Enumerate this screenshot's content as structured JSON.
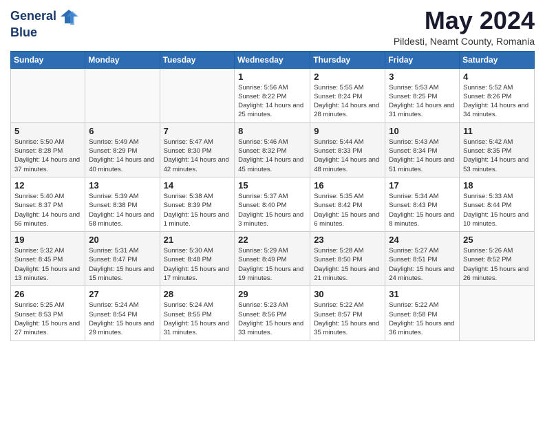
{
  "header": {
    "logo_line1": "General",
    "logo_line2": "Blue",
    "month": "May 2024",
    "location": "Pildesti, Neamt County, Romania"
  },
  "weekdays": [
    "Sunday",
    "Monday",
    "Tuesday",
    "Wednesday",
    "Thursday",
    "Friday",
    "Saturday"
  ],
  "weeks": [
    [
      {
        "day": "",
        "info": ""
      },
      {
        "day": "",
        "info": ""
      },
      {
        "day": "",
        "info": ""
      },
      {
        "day": "1",
        "info": "Sunrise: 5:56 AM\nSunset: 8:22 PM\nDaylight: 14 hours and 25 minutes."
      },
      {
        "day": "2",
        "info": "Sunrise: 5:55 AM\nSunset: 8:24 PM\nDaylight: 14 hours and 28 minutes."
      },
      {
        "day": "3",
        "info": "Sunrise: 5:53 AM\nSunset: 8:25 PM\nDaylight: 14 hours and 31 minutes."
      },
      {
        "day": "4",
        "info": "Sunrise: 5:52 AM\nSunset: 8:26 PM\nDaylight: 14 hours and 34 minutes."
      }
    ],
    [
      {
        "day": "5",
        "info": "Sunrise: 5:50 AM\nSunset: 8:28 PM\nDaylight: 14 hours and 37 minutes."
      },
      {
        "day": "6",
        "info": "Sunrise: 5:49 AM\nSunset: 8:29 PM\nDaylight: 14 hours and 40 minutes."
      },
      {
        "day": "7",
        "info": "Sunrise: 5:47 AM\nSunset: 8:30 PM\nDaylight: 14 hours and 42 minutes."
      },
      {
        "day": "8",
        "info": "Sunrise: 5:46 AM\nSunset: 8:32 PM\nDaylight: 14 hours and 45 minutes."
      },
      {
        "day": "9",
        "info": "Sunrise: 5:44 AM\nSunset: 8:33 PM\nDaylight: 14 hours and 48 minutes."
      },
      {
        "day": "10",
        "info": "Sunrise: 5:43 AM\nSunset: 8:34 PM\nDaylight: 14 hours and 51 minutes."
      },
      {
        "day": "11",
        "info": "Sunrise: 5:42 AM\nSunset: 8:35 PM\nDaylight: 14 hours and 53 minutes."
      }
    ],
    [
      {
        "day": "12",
        "info": "Sunrise: 5:40 AM\nSunset: 8:37 PM\nDaylight: 14 hours and 56 minutes."
      },
      {
        "day": "13",
        "info": "Sunrise: 5:39 AM\nSunset: 8:38 PM\nDaylight: 14 hours and 58 minutes."
      },
      {
        "day": "14",
        "info": "Sunrise: 5:38 AM\nSunset: 8:39 PM\nDaylight: 15 hours and 1 minute."
      },
      {
        "day": "15",
        "info": "Sunrise: 5:37 AM\nSunset: 8:40 PM\nDaylight: 15 hours and 3 minutes."
      },
      {
        "day": "16",
        "info": "Sunrise: 5:35 AM\nSunset: 8:42 PM\nDaylight: 15 hours and 6 minutes."
      },
      {
        "day": "17",
        "info": "Sunrise: 5:34 AM\nSunset: 8:43 PM\nDaylight: 15 hours and 8 minutes."
      },
      {
        "day": "18",
        "info": "Sunrise: 5:33 AM\nSunset: 8:44 PM\nDaylight: 15 hours and 10 minutes."
      }
    ],
    [
      {
        "day": "19",
        "info": "Sunrise: 5:32 AM\nSunset: 8:45 PM\nDaylight: 15 hours and 13 minutes."
      },
      {
        "day": "20",
        "info": "Sunrise: 5:31 AM\nSunset: 8:47 PM\nDaylight: 15 hours and 15 minutes."
      },
      {
        "day": "21",
        "info": "Sunrise: 5:30 AM\nSunset: 8:48 PM\nDaylight: 15 hours and 17 minutes."
      },
      {
        "day": "22",
        "info": "Sunrise: 5:29 AM\nSunset: 8:49 PM\nDaylight: 15 hours and 19 minutes."
      },
      {
        "day": "23",
        "info": "Sunrise: 5:28 AM\nSunset: 8:50 PM\nDaylight: 15 hours and 21 minutes."
      },
      {
        "day": "24",
        "info": "Sunrise: 5:27 AM\nSunset: 8:51 PM\nDaylight: 15 hours and 24 minutes."
      },
      {
        "day": "25",
        "info": "Sunrise: 5:26 AM\nSunset: 8:52 PM\nDaylight: 15 hours and 26 minutes."
      }
    ],
    [
      {
        "day": "26",
        "info": "Sunrise: 5:25 AM\nSunset: 8:53 PM\nDaylight: 15 hours and 27 minutes."
      },
      {
        "day": "27",
        "info": "Sunrise: 5:24 AM\nSunset: 8:54 PM\nDaylight: 15 hours and 29 minutes."
      },
      {
        "day": "28",
        "info": "Sunrise: 5:24 AM\nSunset: 8:55 PM\nDaylight: 15 hours and 31 minutes."
      },
      {
        "day": "29",
        "info": "Sunrise: 5:23 AM\nSunset: 8:56 PM\nDaylight: 15 hours and 33 minutes."
      },
      {
        "day": "30",
        "info": "Sunrise: 5:22 AM\nSunset: 8:57 PM\nDaylight: 15 hours and 35 minutes."
      },
      {
        "day": "31",
        "info": "Sunrise: 5:22 AM\nSunset: 8:58 PM\nDaylight: 15 hours and 36 minutes."
      },
      {
        "day": "",
        "info": ""
      }
    ]
  ]
}
